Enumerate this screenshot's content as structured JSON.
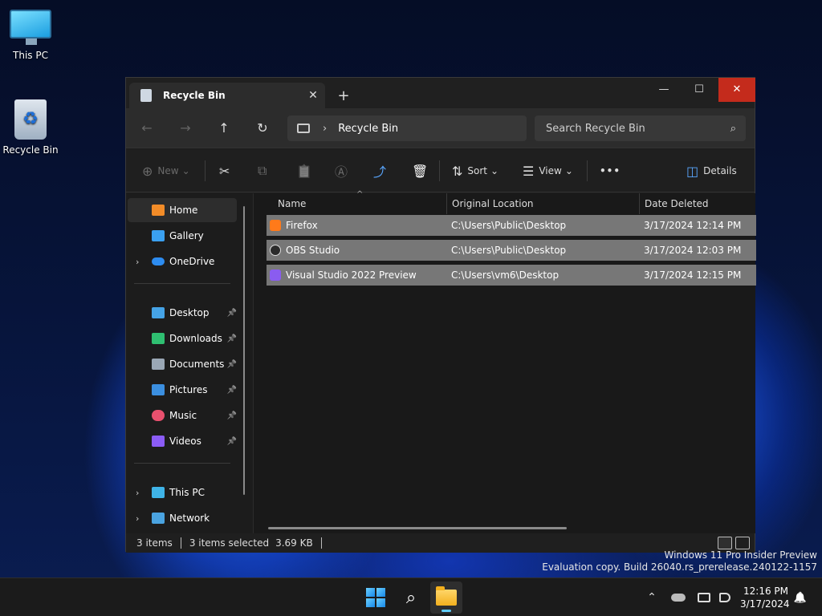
{
  "desktop": {
    "icons": [
      {
        "label": "This PC"
      },
      {
        "label": "Recycle Bin"
      }
    ]
  },
  "window": {
    "tab_title": "Recycle Bin",
    "close_glyph": "✕",
    "new_tab_glyph": "+",
    "controls": {
      "minimize": "—",
      "maximize": "☐",
      "close": "✕"
    }
  },
  "address_bar": {
    "back": "←",
    "forward": "→",
    "up": "↑",
    "refresh": "↻",
    "path_sep": "›",
    "path": "Recycle Bin",
    "search_placeholder": "Search Recycle Bin",
    "search_icon": "⌕"
  },
  "toolbar": {
    "new_label": "New",
    "new_icon": "⊕",
    "cut_icon": "✂",
    "copy_icon": "⧉",
    "paste_icon": "📋",
    "rename_icon": "Ⓐ",
    "share_icon": "⤴",
    "delete_icon": "🗑",
    "sort_label": "Sort",
    "sort_icon": "⇅",
    "view_label": "View",
    "view_icon": "☰",
    "more_label": "•••",
    "details_label": "Details",
    "details_icon": "◫",
    "dropdown": "⌄"
  },
  "sidebar": {
    "items": [
      {
        "label": "Home",
        "color": "#f28c28"
      },
      {
        "label": "Gallery",
        "color": "#3aa0f0"
      },
      {
        "label": "OneDrive",
        "color": "#2d8cf0"
      },
      {
        "label": "Desktop",
        "color": "#45a3e6"
      },
      {
        "label": "Downloads",
        "color": "#2fbf71"
      },
      {
        "label": "Documents",
        "color": "#9aa7b5"
      },
      {
        "label": "Pictures",
        "color": "#3b8fe0"
      },
      {
        "label": "Music",
        "color": "#e8506e"
      },
      {
        "label": "Videos",
        "color": "#8b5cf6"
      },
      {
        "label": "This PC",
        "color": "#3fb4e8"
      },
      {
        "label": "Network",
        "color": "#4aa3e0"
      }
    ],
    "pin_glyph": "📌",
    "chevron": "›"
  },
  "file_list": {
    "columns": [
      "Name",
      "Original Location",
      "Date Deleted"
    ],
    "sort_caret": "^",
    "rows": [
      {
        "name": "Firefox",
        "location": "C:\\Users\\Public\\Desktop",
        "date": "3/17/2024 12:14 PM",
        "icon_color": "#ff7a1a"
      },
      {
        "name": "OBS Studio",
        "location": "C:\\Users\\Public\\Desktop",
        "date": "3/17/2024 12:03 PM",
        "icon_color": "#2b2b2b"
      },
      {
        "name": "Visual Studio 2022 Preview",
        "location": "C:\\Users\\vm6\\Desktop",
        "date": "3/17/2024 12:15 PM",
        "icon_color": "#8a5cf0"
      }
    ]
  },
  "status": {
    "item_count": "3 items",
    "selection": "3 items selected",
    "size": "3.69 KB"
  },
  "watermark": {
    "line1": "Windows 11 Pro Insider Preview",
    "line2": "Evaluation copy. Build 26040.rs_prerelease.240122-1157"
  },
  "taskbar": {
    "search_icon": "⌕",
    "tray_chevron": "⌃",
    "time": "12:16 PM",
    "date": "3/17/2024",
    "bell": "🔔"
  }
}
